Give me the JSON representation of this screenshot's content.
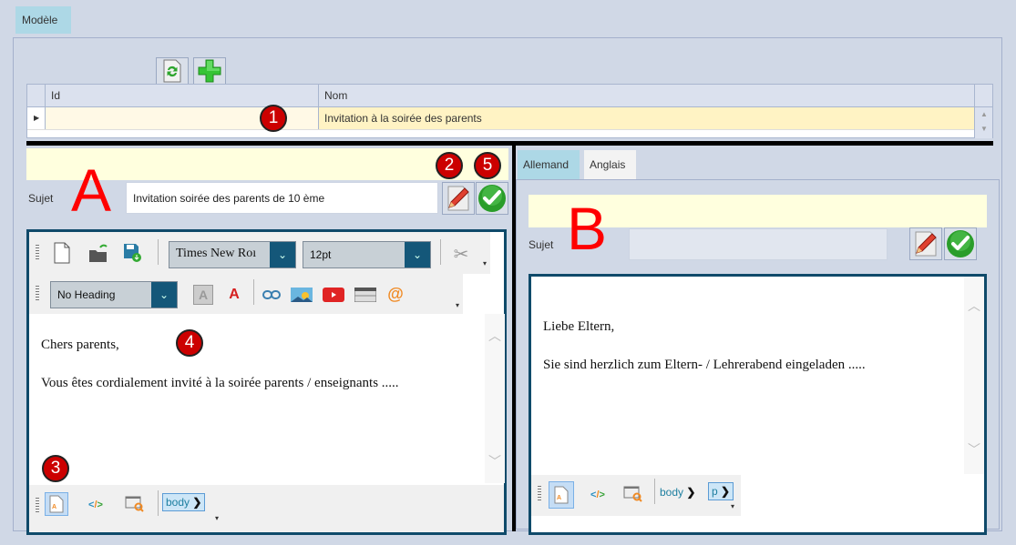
{
  "top_tab": {
    "label": "Modèle"
  },
  "toolbar": {
    "refresh_icon": "refresh-document-icon",
    "add_icon": "green-plus-icon"
  },
  "grid": {
    "columns": [
      {
        "label": "Id"
      },
      {
        "label": "Nom"
      }
    ],
    "rows": [
      {
        "id": "",
        "nom": "Invitation à la soirée des parents",
        "selected": true
      }
    ]
  },
  "markers": [
    "1",
    "2",
    "3",
    "4",
    "5"
  ],
  "annotations": {
    "left": "A",
    "right": "B"
  },
  "left_panel": {
    "subject_label": "Sujet",
    "subject_value": "Invitation soirée des parents de 10 ème",
    "editor": {
      "font_family": "Times New Roman",
      "font_family_display": "Times New Roı",
      "font_size": "12pt",
      "heading": "No Heading",
      "content": [
        "Chers parents,",
        "Vous êtes cordialement invité à la soirée parents / enseignants ....."
      ],
      "breadcrumb": [
        "body"
      ]
    }
  },
  "right_panel": {
    "tabs": [
      {
        "label": "Allemand",
        "active": true
      },
      {
        "label": "Anglais",
        "active": false
      }
    ],
    "subject_label": "Sujet",
    "subject_value": "",
    "editor": {
      "content": [
        "Liebe Eltern,",
        "Sie sind herzlich zum Eltern- / Lehrerabend eingeladen ....."
      ],
      "breadcrumb": [
        "body",
        "p"
      ]
    }
  },
  "colors": {
    "background": "#d0d8e6",
    "active_tab": "#add8e6",
    "selected_row": "#fff3c4",
    "marker": "#cc0000",
    "editor_border": "#0f4a6a",
    "annotation": "#ff0000"
  }
}
